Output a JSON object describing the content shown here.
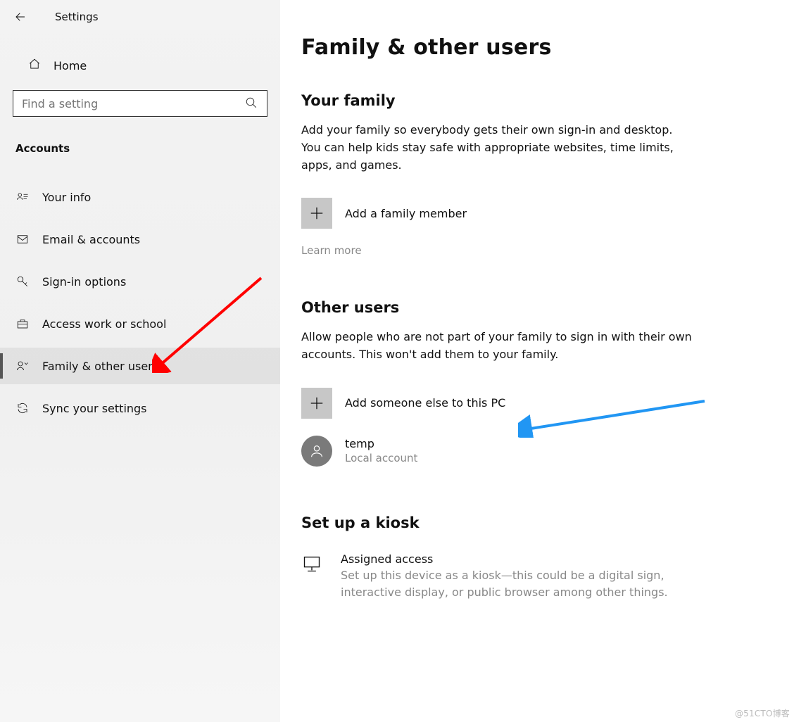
{
  "app_title": "Settings",
  "sidebar": {
    "home_label": "Home",
    "search_placeholder": "Find a setting",
    "group_title": "Accounts",
    "items": [
      {
        "label": "Your info"
      },
      {
        "label": "Email & accounts"
      },
      {
        "label": "Sign-in options"
      },
      {
        "label": "Access work or school"
      },
      {
        "label": "Family & other users",
        "selected": true
      },
      {
        "label": "Sync your settings"
      }
    ]
  },
  "main": {
    "page_title": "Family & other users",
    "family": {
      "heading": "Your family",
      "desc": "Add your family so everybody gets their own sign-in and desktop. You can help kids stay safe with appropriate websites, time limits, apps, and games.",
      "add_label": "Add a family member",
      "learn_more": "Learn more"
    },
    "other": {
      "heading": "Other users",
      "desc": "Allow people who are not part of your family to sign in with their own accounts. This won't add them to your family.",
      "add_label": "Add someone else to this PC",
      "users": [
        {
          "name": "temp",
          "sub": "Local account"
        }
      ]
    },
    "kiosk": {
      "heading": "Set up a kiosk",
      "item_title": "Assigned access",
      "item_desc": "Set up this device as a kiosk—this could be a digital sign, interactive display, or public browser among other things."
    }
  },
  "watermark": "@51CTO博客"
}
